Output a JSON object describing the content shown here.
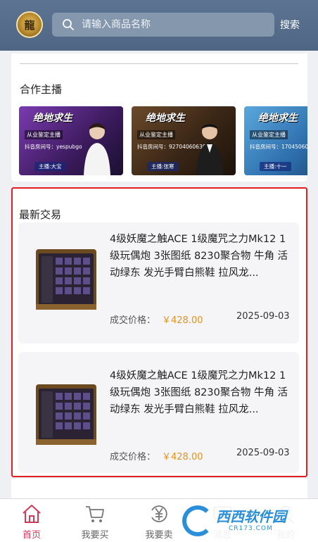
{
  "header": {
    "logo_glyph": "龍",
    "search_placeholder": "请输入商品名称",
    "search_button": "搜索"
  },
  "streamers": {
    "title": "合作主播",
    "cards": [
      {
        "title": "绝地求生",
        "subtitle": "从业鉴定主播",
        "douyin": "抖音房间号：yespubgo",
        "host": "主播:大宝",
        "bg": "#5b2a8a"
      },
      {
        "title": "绝地求生",
        "subtitle": "从业鉴定主播",
        "douyin": "抖音房间号：92704060639",
        "host": "主播:张寒",
        "bg": "#3a2616"
      },
      {
        "title": "绝地求生",
        "subtitle": "从业鉴定主播",
        "douyin": "抖音房间号：17045060",
        "host": "主播:十一",
        "bg": "#2e6fae"
      }
    ]
  },
  "trades": {
    "title": "最新交易",
    "items": [
      {
        "description": "4级妖魔之触ACE 1级魔咒之力Mk12 1级玩偶炮 3张图纸 8230聚合物 牛角 活动绿东 发光手臂白熊鞋 拉风龙...",
        "price_label": "成交价格：",
        "price": "￥428.00",
        "date": "2025-09-03"
      },
      {
        "description": "4级妖魔之触ACE 1级魔咒之力Mk12 1级玩偶炮 3张图纸 8230聚合物 牛角 活动绿东 发光手臂白熊鞋 拉风龙...",
        "price_label": "成交价格：",
        "price": "￥428.00",
        "date": "2025-09-03"
      }
    ]
  },
  "tabbar": {
    "tabs": [
      {
        "label": "首页",
        "icon": "home-icon",
        "active": true
      },
      {
        "label": "我要买",
        "icon": "cart-icon",
        "active": false
      },
      {
        "label": "我要卖",
        "icon": "yuan-icon",
        "active": false
      },
      {
        "label": "消息",
        "icon": "message-icon",
        "active": false
      },
      {
        "label": "我的",
        "icon": "user-icon",
        "active": false
      }
    ]
  },
  "watermark": {
    "name": "西西软件园",
    "url": "CR173.COM"
  },
  "colors": {
    "header": "#566e8b",
    "accent": "#d23a5a",
    "price": "#e39320",
    "highlight_border": "#e02020"
  }
}
